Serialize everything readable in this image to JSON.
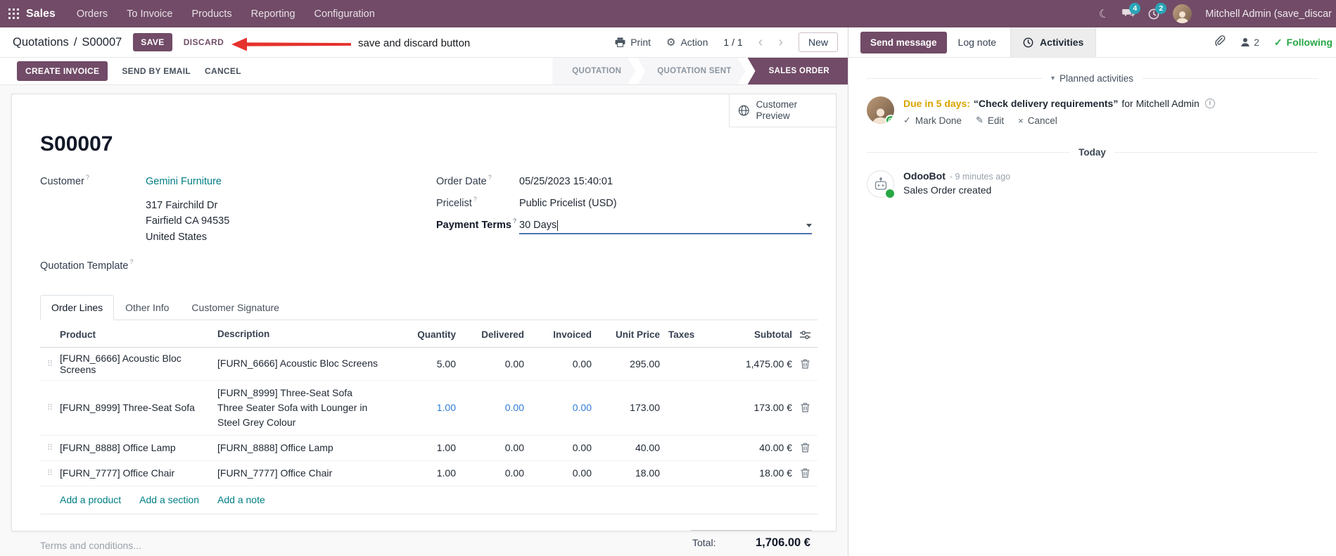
{
  "colors": {
    "brand": "#714B67",
    "link_teal": "#017e84",
    "edited_blue": "#2e7cd6",
    "notification_badge": "#2aa5b8",
    "success_green": "#28a745",
    "activity_due_orange": "#d9a300",
    "annotation_red": "#e5322d"
  },
  "topbar": {
    "brand": "Sales",
    "menus": [
      "Orders",
      "To Invoice",
      "Products",
      "Reporting",
      "Configuration"
    ],
    "messages_badge": "4",
    "activities_badge": "2",
    "user_name": "Mitchell Admin (save_discar"
  },
  "control_panel": {
    "breadcrumb_parent": "Quotations",
    "breadcrumb_sep": "/",
    "breadcrumb_current": "S00007",
    "save": "SAVE",
    "discard": "DISCARD",
    "print": "Print",
    "action": "Action",
    "pager": "1 / 1",
    "prev": "‹",
    "next": "›",
    "new": "New"
  },
  "annotation": {
    "text": "save and discard button"
  },
  "statusbar": {
    "create_invoice": "CREATE INVOICE",
    "send_by_email": "SEND BY EMAIL",
    "cancel": "CANCEL",
    "steps": [
      "QUOTATION",
      "QUOTATION SENT",
      "SALES ORDER"
    ],
    "active_step": "SALES ORDER"
  },
  "form": {
    "customer_preview": "Customer Preview",
    "title": "S00007",
    "hint": "?",
    "customer_label": "Customer",
    "customer_name": "Gemini Furniture",
    "address": [
      "317 Fairchild Dr",
      "Fairfield CA 94535",
      "United States"
    ],
    "quotation_template_label": "Quotation Template",
    "order_date_label": "Order Date",
    "order_date_value": "05/25/2023 15:40:01",
    "pricelist_label": "Pricelist",
    "pricelist_value": "Public Pricelist (USD)",
    "payment_terms_label": "Payment Terms",
    "payment_terms_value": "30 Days",
    "tabs": [
      "Order Lines",
      "Other Info",
      "Customer Signature"
    ],
    "active_tab": "Order Lines"
  },
  "order_lines": {
    "headers": {
      "product": "Product",
      "description": "Description",
      "quantity": "Quantity",
      "delivered": "Delivered",
      "invoiced": "Invoiced",
      "unit_price": "Unit Price",
      "taxes": "Taxes",
      "subtotal": "Subtotal"
    },
    "rows": [
      {
        "product": "[FURN_6666] Acoustic Bloc Screens",
        "description": "[FURN_6666] Acoustic Bloc Screens",
        "quantity": "5.00",
        "delivered": "0.00",
        "invoiced": "0.00",
        "unit_price": "295.00",
        "taxes": "",
        "subtotal": "1,475.00 €"
      },
      {
        "product": "[FURN_8999] Three-Seat Sofa",
        "description": "[FURN_8999] Three-Seat Sofa",
        "description2": "Three Seater Sofa with Lounger in Steel Grey Colour",
        "quantity": "1.00",
        "delivered": "0.00",
        "invoiced": "0.00",
        "unit_price": "173.00",
        "taxes": "",
        "subtotal": "173.00 €"
      },
      {
        "product": "[FURN_8888] Office Lamp",
        "description": "[FURN_8888] Office Lamp",
        "quantity": "1.00",
        "delivered": "0.00",
        "invoiced": "0.00",
        "unit_price": "40.00",
        "taxes": "",
        "subtotal": "40.00 €"
      },
      {
        "product": "[FURN_7777] Office Chair",
        "description": "[FURN_7777] Office Chair",
        "quantity": "1.00",
        "delivered": "0.00",
        "invoiced": "0.00",
        "unit_price": "18.00",
        "taxes": "",
        "subtotal": "18.00 €"
      }
    ],
    "add_product": "Add a product",
    "add_section": "Add a section",
    "add_note": "Add a note",
    "terms_placeholder": "Terms and conditions...",
    "total_label": "Total:",
    "total_value": "1,706.00 €"
  },
  "chatter": {
    "send_message": "Send message",
    "log_note": "Log note",
    "activities_tab": "Activities",
    "followers_count": "2",
    "following": "Following",
    "following_check": "✓",
    "planned_title": "Planned activities",
    "activity": {
      "due": "Due in 5 days:",
      "summary": "“Check delivery requirements”",
      "assignee": "for Mitchell Admin",
      "mark_done": "Mark Done",
      "edit": "Edit",
      "cancel": "Cancel",
      "mark_done_icon": "✓",
      "edit_icon": "✎",
      "cancel_icon": "×",
      "info": "i"
    },
    "today": "Today",
    "message": {
      "author": "OdooBot",
      "time": "- 9 minutes ago",
      "body": "Sales Order created"
    }
  }
}
